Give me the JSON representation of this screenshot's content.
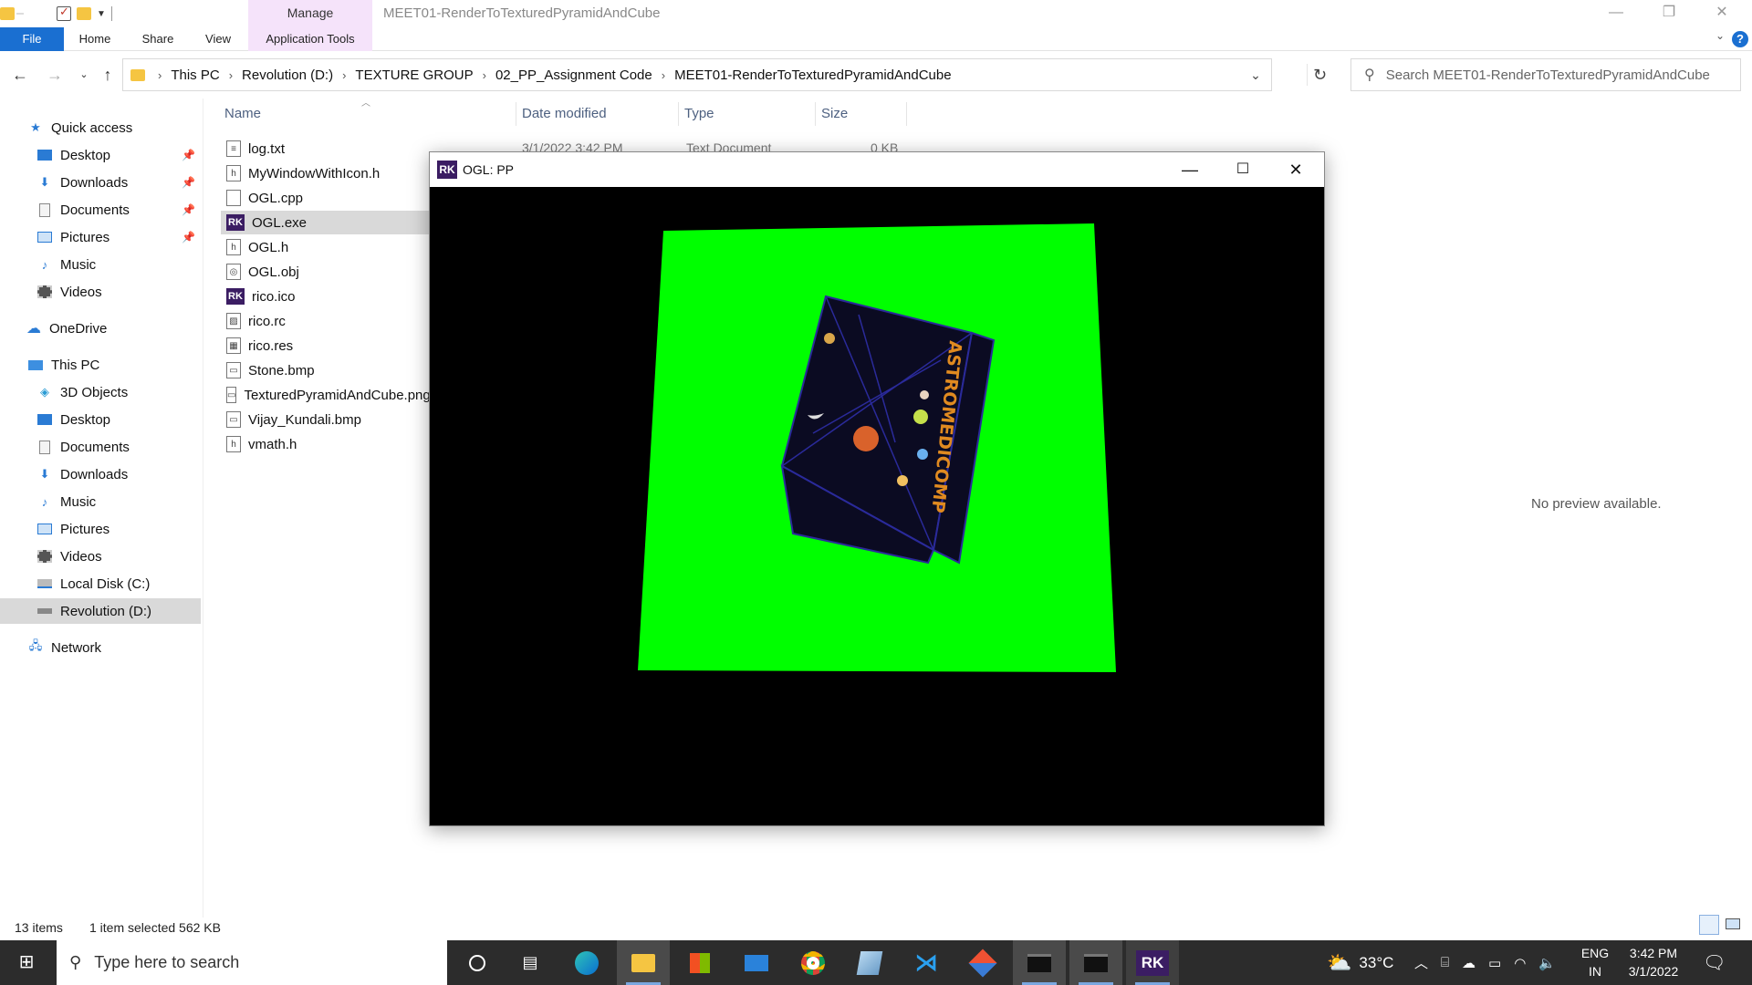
{
  "window": {
    "title": "MEET01-RenderToTexturedPyramidAndCube",
    "manage_label": "Manage",
    "app_tools_label": "Application Tools",
    "minimize": "—",
    "restore": "❐",
    "close": "✕"
  },
  "ribbon": {
    "tabs": [
      "File",
      "Home",
      "Share",
      "View"
    ],
    "help": "?"
  },
  "address": {
    "crumbs": [
      "This PC",
      "Revolution (D:)",
      "TEXTURE GROUP",
      "02_PP_Assignment Code",
      "MEET01-RenderToTexturedPyramidAndCube"
    ],
    "search_placeholder": "Search MEET01-RenderToTexturedPyramidAndCube"
  },
  "sidebar": {
    "quick_access": "Quick access",
    "quick_items": [
      "Desktop",
      "Downloads",
      "Documents",
      "Pictures",
      "Music",
      "Videos"
    ],
    "onedrive": "OneDrive",
    "this_pc": "This PC",
    "pc_items": [
      "3D Objects",
      "Desktop",
      "Documents",
      "Downloads",
      "Music",
      "Pictures",
      "Videos",
      "Local Disk (C:)",
      "Revolution (D:)"
    ],
    "network": "Network"
  },
  "columns": {
    "name": "Name",
    "date": "Date modified",
    "type": "Type",
    "size": "Size"
  },
  "files": [
    {
      "name": "log.txt",
      "icon": "text-file-icon"
    },
    {
      "name": "MyWindowWithIcon.h",
      "icon": "header-file-icon"
    },
    {
      "name": "OGL.cpp",
      "icon": "cpp-file-icon"
    },
    {
      "name": "OGL.exe",
      "icon": "rk-app-icon"
    },
    {
      "name": "OGL.h",
      "icon": "header-file-icon"
    },
    {
      "name": "OGL.obj",
      "icon": "obj-file-icon"
    },
    {
      "name": "rico.ico",
      "icon": "rk-app-icon"
    },
    {
      "name": "rico.rc",
      "icon": "rc-file-icon"
    },
    {
      "name": "rico.res",
      "icon": "res-file-icon"
    },
    {
      "name": "Stone.bmp",
      "icon": "image-file-icon"
    },
    {
      "name": "TexturedPyramidAndCube.png",
      "icon": "image-file-icon"
    },
    {
      "name": "Vijay_Kundali.bmp",
      "icon": "image-file-icon"
    },
    {
      "name": "vmath.h",
      "icon": "header-file-icon"
    }
  ],
  "first_row_meta": {
    "date": "3/1/2022 3:42 PM",
    "type": "Text Document",
    "size": "0 KB"
  },
  "preview": "No preview available.",
  "status": {
    "count": "13 items",
    "selection": "1 item selected  562 KB"
  },
  "ogl_window": {
    "icon_text": "RK",
    "title": "OGL: PP",
    "cube_text": "ASTROMEDICOMP",
    "colors": {
      "quad": "#00ff00",
      "background": "#000000",
      "cube": "#0b0b22",
      "cube_edges": "#2a2a9a"
    }
  },
  "taskbar": {
    "search_placeholder": "Type here to search",
    "weather": "33°C",
    "lang_top": "ENG",
    "lang_bottom": "IN",
    "time": "3:42 PM",
    "date": "3/1/2022",
    "rk_label": "RK"
  }
}
